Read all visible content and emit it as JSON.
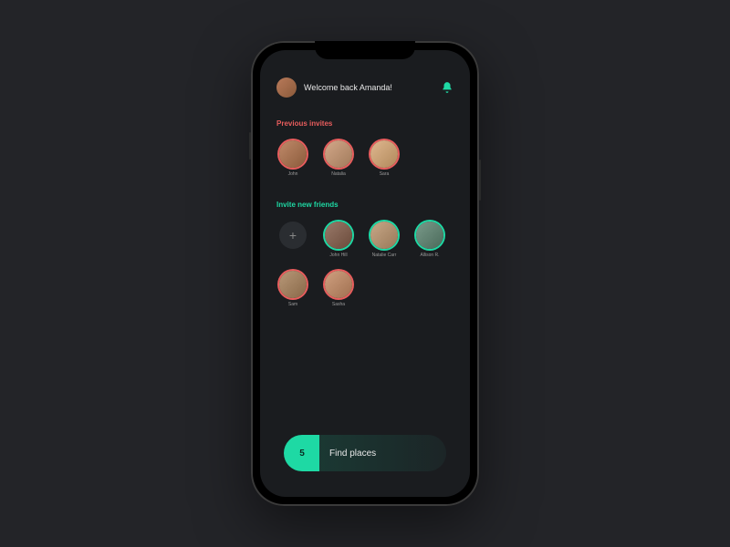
{
  "header": {
    "welcome_text": "Welcome back Amanda!"
  },
  "sections": {
    "previous": {
      "title": "Previous invites",
      "friends": [
        {
          "name": "John"
        },
        {
          "name": "Natalia"
        },
        {
          "name": "Sara"
        }
      ]
    },
    "invite": {
      "title": "Invite new friends",
      "add_label": "+",
      "friends": [
        {
          "name": "John Hill"
        },
        {
          "name": "Natalie Carr"
        },
        {
          "name": "Allison R."
        },
        {
          "name": "Sam"
        },
        {
          "name": "Sasha"
        }
      ]
    }
  },
  "cta": {
    "count": "5",
    "label": "Find places"
  },
  "colors": {
    "accent_teal": "#1ed9a4",
    "accent_red": "#e85d5d",
    "bg": "#1a1c1f"
  }
}
